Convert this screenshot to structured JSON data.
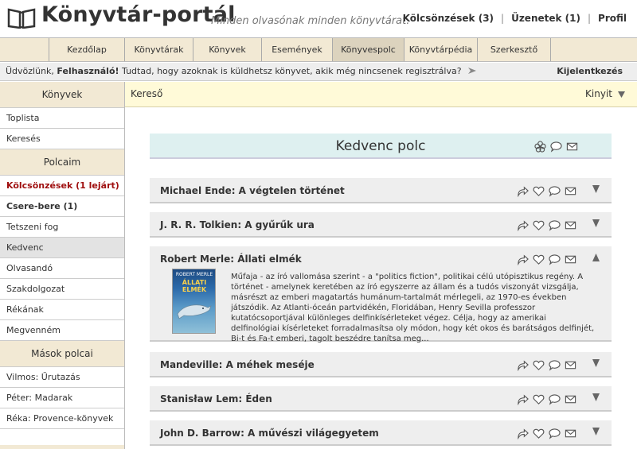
{
  "header": {
    "title": "Könyvtár-portál",
    "tagline": "Minden olvasónak minden könyvtárat.",
    "links": [
      {
        "label": "Kölcsönzések (3)"
      },
      {
        "label": "Üzenetek (1)"
      },
      {
        "label": "Profil"
      }
    ]
  },
  "nav": {
    "tabs": [
      {
        "label": "Kezdőlap",
        "width": 0
      },
      {
        "label": "Könyvtárak"
      },
      {
        "label": "Könyvek"
      },
      {
        "label": "Események"
      },
      {
        "label": "Könyvespolc"
      },
      {
        "label": "Könyvtárpédia"
      },
      {
        "label": "Szerkesztő"
      }
    ],
    "active": "Könyvespolc"
  },
  "welcome": {
    "greeting": "Üdvözlünk,",
    "user": "Felhasználó!",
    "tip": "Tudtad, hogy azoknak is küldhetsz könyvet, akik még nincsenek regisztrálva?",
    "logout": "Kijelentkezés"
  },
  "sidebar": {
    "books_heading": "Könyvek",
    "books_items": [
      {
        "label": "Toplista"
      },
      {
        "label": "Keresés"
      }
    ],
    "shelves_heading": "Polcaim",
    "shelves_items": [
      {
        "label": "Kölcsönzések (1 lejárt)"
      },
      {
        "label": "Csere-bere (1)"
      },
      {
        "label": "Tetszeni fog"
      },
      {
        "label": "Kedvenc"
      },
      {
        "label": "Olvasandó"
      },
      {
        "label": "Szakdolgozat"
      },
      {
        "label": "Rékának"
      },
      {
        "label": "Megvenném"
      }
    ],
    "others_heading": "Mások polcai",
    "others_items": [
      {
        "label": "Vilmos: Űrutazás"
      },
      {
        "label": "Péter: Madarak"
      },
      {
        "label": "Réka: Provence-könyvek"
      }
    ]
  },
  "search": {
    "label": "Kereső",
    "toggle": "Kinyit"
  },
  "shelf": {
    "title": "Kedvenc polc",
    "books": [
      {
        "title": "Michael Ende: A végtelen történet"
      },
      {
        "title": "J. R. R. Tolkien: A gyűrűk ura"
      },
      {
        "title": "Robert Merle: Állati elmék",
        "cover_author": "ROBERT MERLE",
        "cover_title": "ÁLLATI ELMÉK",
        "description": "Műfaja - az író vallomása szerint - a \"politics fiction\", politikai célú utópisztikus regény. A történet - amelynek keretében az író egyszerre az állam és a tudós viszonyát vizsgálja, másrészt az emberi magatartás humánum-tartalmát mérlegeli, az 1970-es években játszódik. Az Atlanti-óceán partvidékén, Floridában, Henry Sevilla professzor kutatócsoportjával különleges delfinkísérleteket végez. Célja, hogy az amerikai delfinológiai kísérleteket forradalmasítsa oly módon, hogy két okos és barátságos delfinjét, Bi-t és Fa-t emberi, tagolt beszédre tanítsa meg..."
      },
      {
        "title": "Mandeville: A méhek meséje"
      },
      {
        "title": "Stanisław Lem: Éden"
      },
      {
        "title": "John D. Barrow: A művészi világegyetem"
      }
    ]
  },
  "icons": {
    "flower": "flower-icon",
    "comment": "speech-bubble-icon",
    "mail": "envelope-icon",
    "share": "share-arrow-icon",
    "heart": "heart-icon",
    "collapse": "triangle-down-icon",
    "expand": "triangle-up-icon"
  },
  "colors": {
    "accent_beige": "#f2e9d4",
    "search_bg": "#fffad8",
    "shelf_header_bg": "#def0f0",
    "alert_red": "#a01010"
  }
}
